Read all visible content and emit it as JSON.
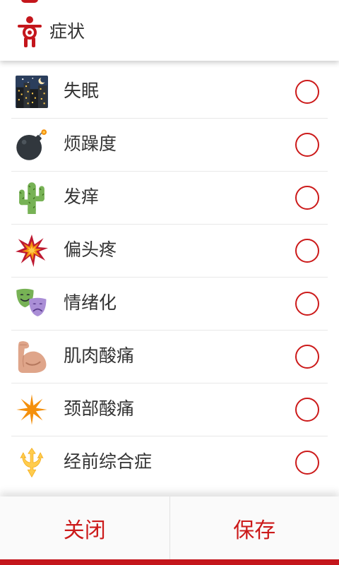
{
  "header": {
    "title": "症状",
    "icon": "person-magnifier-icon"
  },
  "symptoms": [
    {
      "label": "失眠",
      "icon": "city-night-icon",
      "selected": false
    },
    {
      "label": "烦躁度",
      "icon": "bomb-icon",
      "selected": false
    },
    {
      "label": "发痒",
      "icon": "cactus-icon",
      "selected": false
    },
    {
      "label": "偏头疼",
      "icon": "collision-icon",
      "selected": false
    },
    {
      "label": "情绪化",
      "icon": "theater-masks-icon",
      "selected": false
    },
    {
      "label": "肌肉酸痛",
      "icon": "flexed-biceps-icon",
      "selected": false
    },
    {
      "label": "颈部酸痛",
      "icon": "eight-pointed-star-icon",
      "selected": false
    },
    {
      "label": "经前综合症",
      "icon": "trident-emblem-icon",
      "selected": false
    }
  ],
  "footer": {
    "close_label": "关闭",
    "save_label": "保存"
  },
  "colors": {
    "accent": "#cc1a1a",
    "bottom_strip": "#c4161c",
    "text": "#333333",
    "divider": "#e8e8e8",
    "footer_background": "#fafafa"
  }
}
